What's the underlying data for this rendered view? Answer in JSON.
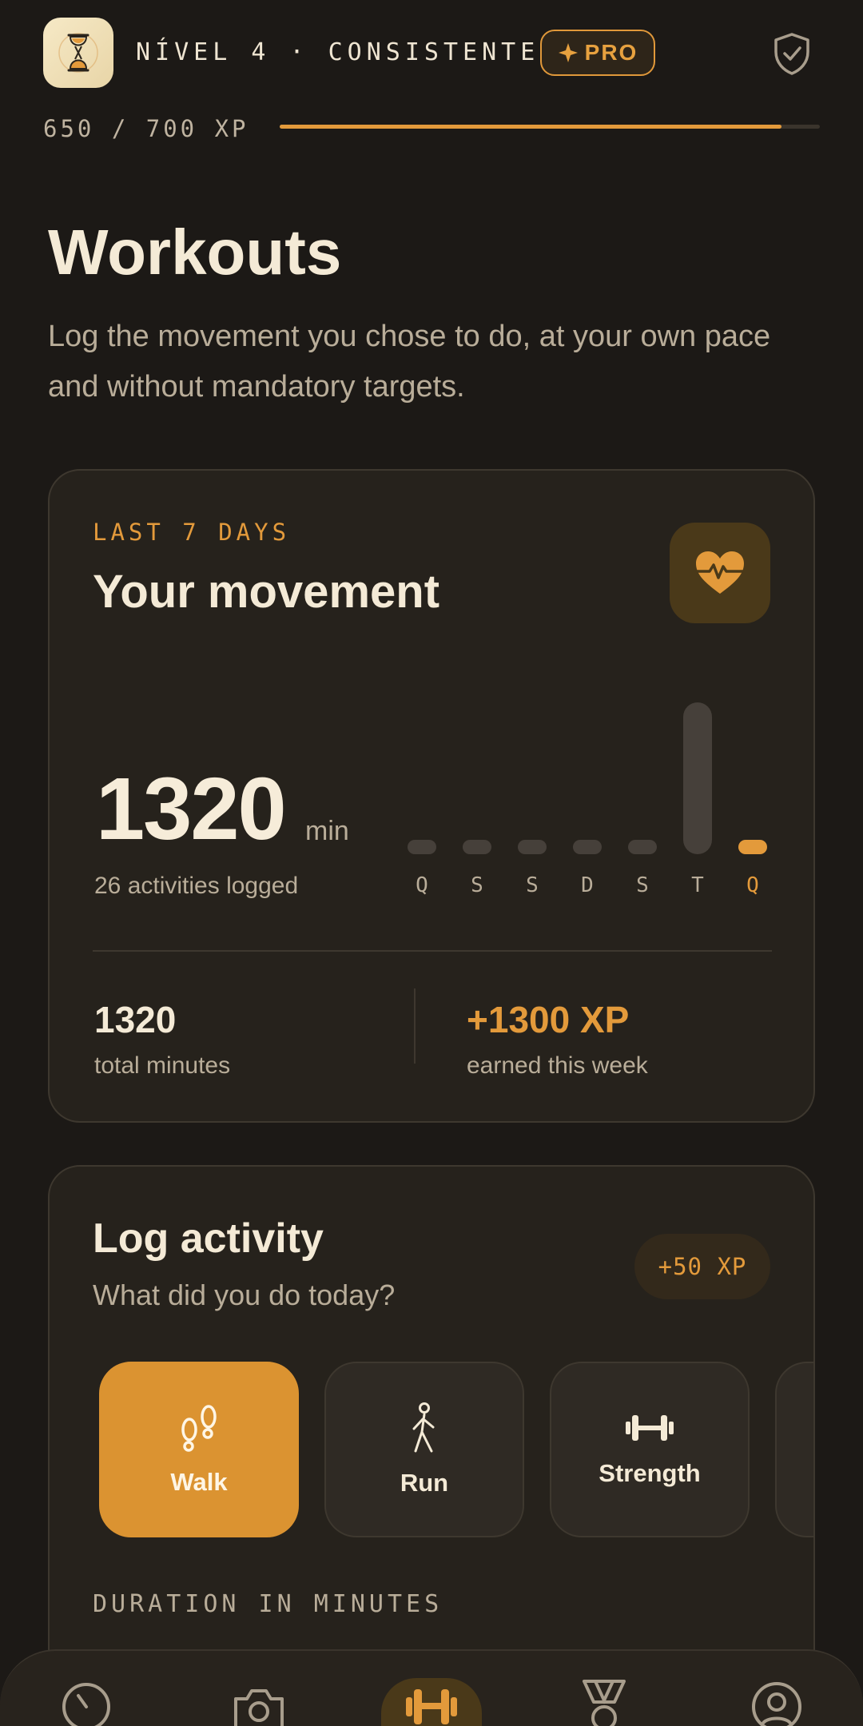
{
  "header": {
    "level_text": "NÍVEL 4 · CONSISTENTE",
    "pro_label": "PRO",
    "logo_icon": "hourglass-icon",
    "shield_icon": "shield-check-icon"
  },
  "xp": {
    "text": "650 / 700 XP",
    "current": 650,
    "max": 700
  },
  "page": {
    "title": "Workouts",
    "subtitle": "Log the movement you chose to do, at your own pace and without mandatory targets."
  },
  "movement": {
    "eyebrow": "LAST 7 DAYS",
    "title": "Your movement",
    "total_value": "1320",
    "unit": "min",
    "activities": "26 activities logged",
    "stats": {
      "total_value": "1320",
      "total_label": "total minutes",
      "xp_value": "+1300 XP",
      "xp_label": "earned this week"
    },
    "days": [
      {
        "label": "Q",
        "value": 0,
        "active": false
      },
      {
        "label": "S",
        "value": 0,
        "active": false
      },
      {
        "label": "S",
        "value": 0,
        "active": false
      },
      {
        "label": "D",
        "value": 0,
        "active": false
      },
      {
        "label": "S",
        "value": 0,
        "active": false
      },
      {
        "label": "T",
        "value": 1320,
        "active": false
      },
      {
        "label": "Q",
        "value": 0,
        "active": true
      }
    ],
    "accent": "#e39a3b"
  },
  "log": {
    "title": "Log activity",
    "subtitle": "What did you do today?",
    "xp_reward": "+50 XP",
    "activities": [
      {
        "label": "Walk",
        "icon": "footprints-icon",
        "selected": true
      },
      {
        "label": "Run",
        "icon": "running-person-icon",
        "selected": false
      },
      {
        "label": "Strength",
        "icon": "dumbbell-icon",
        "selected": false
      }
    ],
    "duration_label": "DURATION IN MINUTES"
  },
  "nav": {
    "items": [
      {
        "icon": "timer-icon",
        "active": false
      },
      {
        "icon": "camera-icon",
        "active": false
      },
      {
        "icon": "dumbbell-icon",
        "active": true
      },
      {
        "icon": "medal-icon",
        "active": false
      },
      {
        "icon": "profile-icon",
        "active": false
      }
    ]
  }
}
